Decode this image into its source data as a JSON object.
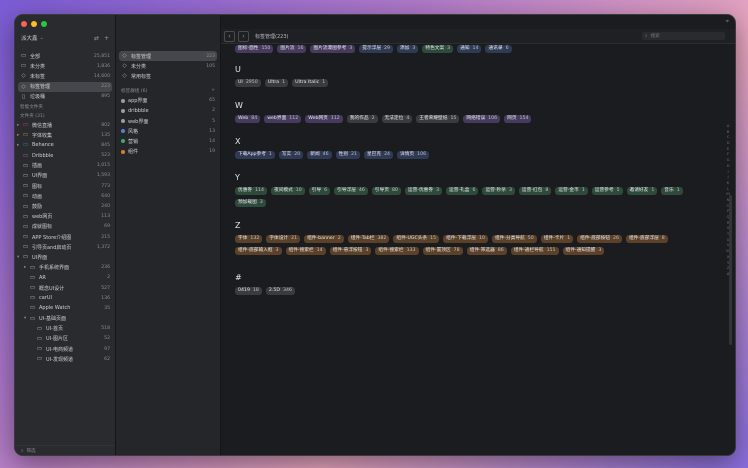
{
  "colors": {
    "bg": "#1b1c1f",
    "purple": "#463a5e",
    "gray": "#3a3b3f",
    "blue": "#2f3a55",
    "green": "#2d4a3a",
    "brown": "#5a4127",
    "accent": "#ff5f57"
  },
  "sidebar": {
    "title": "派大鑫",
    "items": [
      {
        "icon": "folder-icon",
        "label": "全部",
        "count": "25,851",
        "indent": 0
      },
      {
        "icon": "folder-icon",
        "label": "未分类",
        "count": "1,836",
        "indent": 0
      },
      {
        "icon": "tag-icon",
        "label": "未标签",
        "count": "14,600",
        "indent": 0
      },
      {
        "icon": "tag-icon",
        "label": "标签管理",
        "count": "223",
        "indent": 0,
        "selected": true
      },
      {
        "icon": "trash-icon",
        "label": "垃圾桶",
        "count": "895",
        "indent": 0
      }
    ],
    "smart_folder_header": "智能文件夹",
    "folders_header": "文件夹 (31)",
    "folders": [
      {
        "label": "微信直播",
        "count": "802",
        "indent": 0,
        "color": "#c24b4b",
        "arrow": "▸"
      },
      {
        "label": "字体收集",
        "count": "135",
        "indent": 0,
        "color": "#c79a3a",
        "arrow": "▸"
      },
      {
        "label": "Behance",
        "count": "845",
        "indent": 0,
        "color": "#3a7bd5",
        "arrow": "▸"
      },
      {
        "label": "Dribbble",
        "count": "523",
        "indent": 0,
        "color": "#d2559b",
        "arrow": ""
      },
      {
        "label": "插画",
        "count": "1,015",
        "indent": 0,
        "color": "",
        "arrow": ""
      },
      {
        "label": "UI界面",
        "count": "1,593",
        "indent": 0,
        "color": "",
        "arrow": ""
      },
      {
        "label": "图标",
        "count": "773",
        "indent": 0,
        "color": "",
        "arrow": ""
      },
      {
        "label": "动画",
        "count": "640",
        "indent": 0,
        "color": "",
        "arrow": ""
      },
      {
        "label": "鼓励",
        "count": "240",
        "indent": 0,
        "color": "",
        "arrow": ""
      },
      {
        "label": "web网页",
        "count": "113",
        "indent": 0,
        "color": "",
        "arrow": ""
      },
      {
        "label": "成就图标",
        "count": "69",
        "indent": 0,
        "color": "",
        "arrow": ""
      },
      {
        "label": "APP Store介绍图",
        "count": "215",
        "indent": 0,
        "color": "",
        "arrow": ""
      },
      {
        "label": "引导页and启动页",
        "count": "1,372",
        "indent": 0,
        "color": "",
        "arrow": ""
      },
      {
        "label": "UI界面",
        "count": "",
        "indent": 0,
        "color": "",
        "arrow": "▾"
      },
      {
        "label": "手机系统界面",
        "count": "236",
        "indent": 1,
        "color": "",
        "arrow": "▸"
      },
      {
        "label": "AR",
        "count": "2",
        "indent": 1,
        "color": "",
        "arrow": ""
      },
      {
        "label": "概念UI设计",
        "count": "527",
        "indent": 1,
        "color": "",
        "arrow": ""
      },
      {
        "label": "carUI",
        "count": "136",
        "indent": 1,
        "color": "",
        "arrow": ""
      },
      {
        "label": "Apple Watch",
        "count": "35",
        "indent": 1,
        "color": "",
        "arrow": ""
      },
      {
        "label": "UI-基础页面",
        "count": "",
        "indent": 1,
        "color": "",
        "arrow": "▾"
      },
      {
        "label": "UI-首页",
        "count": "518",
        "indent": 2,
        "color": "",
        "arrow": ""
      },
      {
        "label": "UI-图片区",
        "count": "52",
        "indent": 2,
        "color": "",
        "arrow": ""
      },
      {
        "label": "UI-电商频道",
        "count": "97",
        "indent": 2,
        "color": "",
        "arrow": ""
      },
      {
        "label": "UI-发现频道",
        "count": "62",
        "indent": 2,
        "color": "",
        "arrow": ""
      }
    ],
    "filter_placeholder": "筛选"
  },
  "col2": {
    "items": [
      {
        "label": "标签管理",
        "count": "223",
        "selected": true
      },
      {
        "label": "未分类",
        "count": "105"
      },
      {
        "label": "常用标签",
        "count": ""
      }
    ],
    "group_header": "标签群组 (6)",
    "groups": [
      {
        "label": "app界面",
        "count": "65",
        "color": "#9a9aa0"
      },
      {
        "label": "dribbble",
        "count": "2",
        "color": "#9a9aa0"
      },
      {
        "label": "web界面",
        "count": "5",
        "color": "#9a9aa0"
      },
      {
        "label": "风格",
        "count": "13",
        "color": "#5a7bd6"
      },
      {
        "label": "营销",
        "count": "14",
        "color": "#3fa86a"
      },
      {
        "label": "组件",
        "count": "19",
        "color": "#c9822f"
      }
    ]
  },
  "topbar": {
    "title": "标签管理(223)",
    "search_placeholder": "搜索"
  },
  "sections": [
    {
      "letter": "",
      "tags": [
        {
          "t": "图标-面性",
          "n": "150",
          "c": "purple"
        },
        {
          "t": "图片流",
          "n": "16",
          "c": "purple"
        },
        {
          "t": "图片流瀑图参考",
          "n": "3",
          "c": "purple"
        },
        {
          "t": "提示浮层",
          "n": "29",
          "c": "blue"
        },
        {
          "t": "添加",
          "n": "3",
          "c": "blue"
        },
        {
          "t": "特色文案",
          "n": "3",
          "c": "green"
        },
        {
          "t": "通知",
          "n": "14",
          "c": "blue"
        },
        {
          "t": "通讯录",
          "n": "6",
          "c": "blue"
        }
      ]
    },
    {
      "letter": "U",
      "tags": [
        {
          "t": "UI",
          "n": "2950",
          "c": "gray"
        },
        {
          "t": "Ultra",
          "n": "1",
          "c": "gray"
        },
        {
          "t": "Ultra Italic",
          "n": "1",
          "c": "gray"
        }
      ]
    },
    {
      "letter": "W",
      "tags": [
        {
          "t": "Web",
          "n": "84",
          "c": "purple"
        },
        {
          "t": "web界面",
          "n": "112",
          "c": "purple"
        },
        {
          "t": "Web网页",
          "n": "112",
          "c": "purple"
        },
        {
          "t": "我的作品",
          "n": "2",
          "c": "gray"
        },
        {
          "t": "无法定位",
          "n": "4",
          "c": "gray"
        },
        {
          "t": "王者荣耀壁纸",
          "n": "15",
          "c": "gray"
        },
        {
          "t": "网络错误",
          "n": "106",
          "c": "purple"
        },
        {
          "t": "网页",
          "n": "154",
          "c": "purple"
        }
      ]
    },
    {
      "letter": "X",
      "tags": [
        {
          "t": "下载App参考",
          "n": "1",
          "c": "blue"
        },
        {
          "t": "写实",
          "n": "20",
          "c": "blue"
        },
        {
          "t": "新闻",
          "n": "46",
          "c": "blue"
        },
        {
          "t": "性别",
          "n": "21",
          "c": "blue"
        },
        {
          "t": "星巴克",
          "n": "24",
          "c": "blue"
        },
        {
          "t": "详情页",
          "n": "106",
          "c": "blue"
        }
      ]
    },
    {
      "letter": "Y",
      "tags": [
        {
          "t": "优惠券",
          "n": "114",
          "c": "green"
        },
        {
          "t": "夜间模式",
          "n": "10",
          "c": "green"
        },
        {
          "t": "引导",
          "n": "6",
          "c": "green"
        },
        {
          "t": "引导浮层",
          "n": "46",
          "c": "green"
        },
        {
          "t": "引导页",
          "n": "80",
          "c": "green"
        },
        {
          "t": "运营-优惠券",
          "n": "3",
          "c": "green"
        },
        {
          "t": "运营-礼盒",
          "n": "6",
          "c": "green"
        },
        {
          "t": "运营-秒杀",
          "n": "3",
          "c": "green"
        },
        {
          "t": "运营-红包",
          "n": "8",
          "c": "green"
        },
        {
          "t": "运营-金币",
          "n": "1",
          "c": "green"
        },
        {
          "t": "运营参考",
          "n": "5",
          "c": "green"
        },
        {
          "t": "邀请好友",
          "n": "1",
          "c": "green"
        },
        {
          "t": "音乐",
          "n": "1",
          "c": "green"
        },
        {
          "t": "预加载图",
          "n": "3",
          "c": "green"
        }
      ]
    },
    {
      "letter": "Z",
      "tags": [
        {
          "t": "字体",
          "n": "132",
          "c": "brown"
        },
        {
          "t": "字体设计",
          "n": "21",
          "c": "brown"
        },
        {
          "t": "组件-banner",
          "n": "2",
          "c": "brown"
        },
        {
          "t": "组件-Tab栏",
          "n": "382",
          "c": "brown"
        },
        {
          "t": "组件-UGC头条",
          "n": "15",
          "c": "brown"
        },
        {
          "t": "组件-下载浮层",
          "n": "10",
          "c": "brown"
        },
        {
          "t": "组件-分类导航",
          "n": "50",
          "c": "brown"
        },
        {
          "t": "组件-卡片",
          "n": "1",
          "c": "brown"
        },
        {
          "t": "组件-底部按钮",
          "n": "26",
          "c": "brown"
        },
        {
          "t": "组件-底部浮层",
          "n": "8",
          "c": "brown"
        },
        {
          "t": "组件-底部输入框",
          "n": "3",
          "c": "brown"
        },
        {
          "t": "组件-搜索栏",
          "n": "14",
          "c": "brown"
        },
        {
          "t": "组件-悬浮按钮",
          "n": "3",
          "c": "brown"
        },
        {
          "t": "组件-搜索栏",
          "n": "133",
          "c": "brown"
        },
        {
          "t": "组件-置顶区",
          "n": "78",
          "c": "brown"
        },
        {
          "t": "组件-筛选器",
          "n": "86",
          "c": "brown"
        },
        {
          "t": "组件-通栏导航",
          "n": "151",
          "c": "brown"
        },
        {
          "t": "组件-通知提醒",
          "n": "3",
          "c": "brown"
        }
      ]
    },
    {
      "letter": "#",
      "tags": [
        {
          "t": "0419",
          "n": "18",
          "c": "gray"
        },
        {
          "t": "2.5D",
          "n": "346",
          "c": "gray"
        }
      ]
    }
  ],
  "az": [
    "A",
    "B",
    "C",
    "D",
    "E",
    "F",
    "G",
    "H",
    "I",
    "J",
    "K",
    "L",
    "M",
    "N",
    "O",
    "P",
    "Q",
    "R",
    "S",
    "T",
    "U",
    "V",
    "W",
    "X",
    "Y",
    "Z",
    "#"
  ]
}
